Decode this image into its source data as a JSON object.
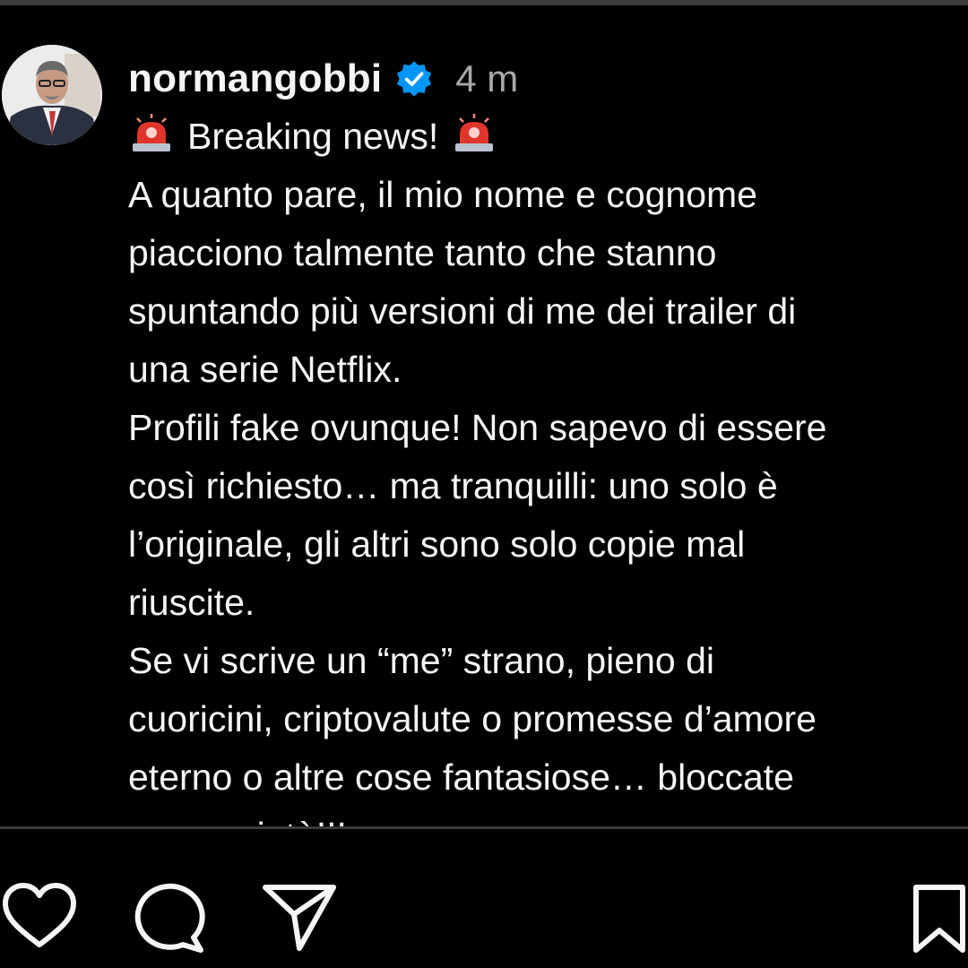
{
  "post": {
    "username": "normangobbi",
    "timestamp": "4 m",
    "verified_icon": "verified-badge-icon",
    "verified_color": "#0095f6",
    "caption": {
      "breaking_emoji": "🚨",
      "breaking_text": "Breaking news!",
      "lines": [
        "A quanto pare, il mio nome e cognome",
        "piacciono talmente tanto che stanno",
        "spuntando più versioni di me dei trailer di",
        "una serie Netflix.",
        "Profili fake ovunque! Non sapevo di essere",
        "così richiesto… ma tranquilli: uno solo è",
        "l’originale, gli altri sono solo copie mal",
        "riuscite.",
        "Se vi scrive un “me” strano, pieno di",
        "cuoricini, criptovalute o promesse d’amore",
        "eterno o altre cose fantasiose… bloccate",
        "senza pietà!!!"
      ]
    }
  },
  "actions": {
    "icons": [
      "heart-icon",
      "comment-icon",
      "share-icon",
      "bookmark-icon"
    ]
  },
  "colors": {
    "background": "#000000",
    "text": "#f5f5f5",
    "muted": "#a8a8a8",
    "siren_red": "#e0352b"
  }
}
